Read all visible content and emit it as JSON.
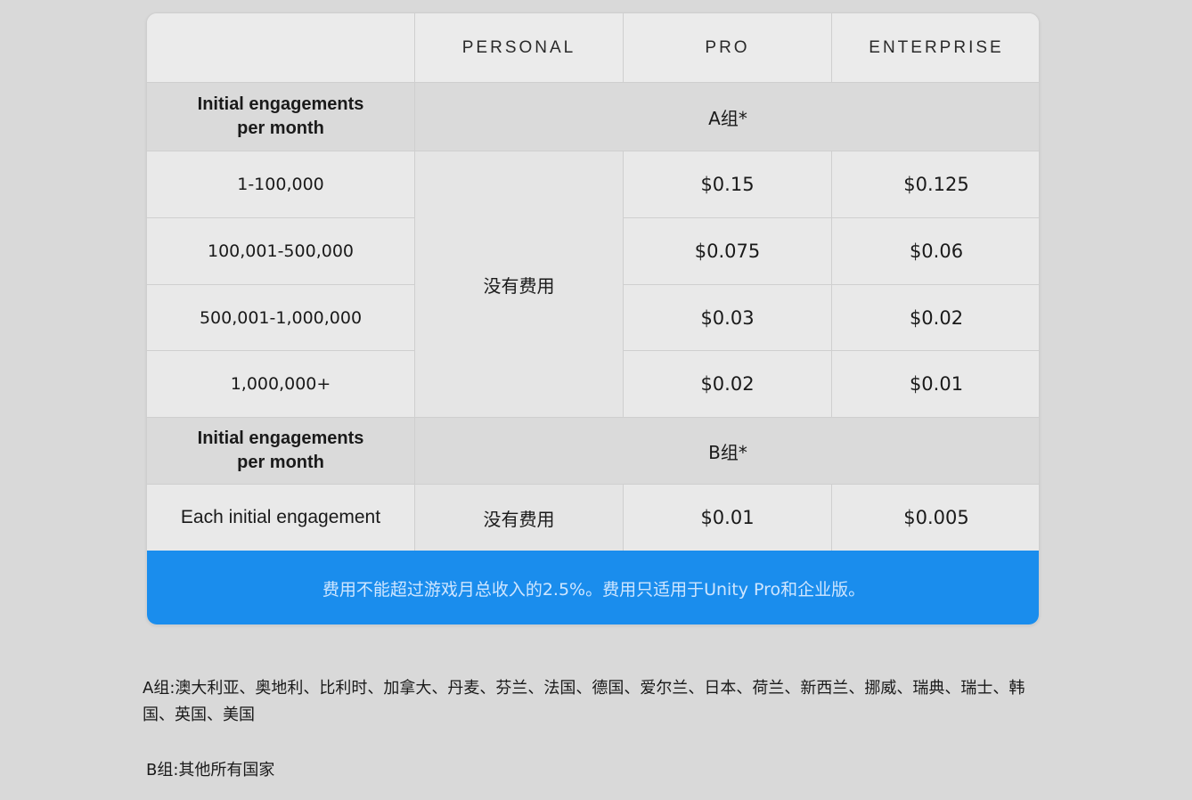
{
  "header": {
    "corner": "",
    "personal": "PERSONAL",
    "pro": "PRO",
    "enterprise": "ENTERPRISE"
  },
  "group_a": {
    "label": "Initial engagements\nper month",
    "title": "A组*",
    "personal_fee": "没有费用",
    "rows": [
      {
        "range": "1-100,000",
        "pro": "$0.15",
        "enterprise": "$0.125"
      },
      {
        "range": "100,001-500,000",
        "pro": "$0.075",
        "enterprise": "$0.06"
      },
      {
        "range": "500,001-1,000,000",
        "pro": "$0.03",
        "enterprise": "$0.02"
      },
      {
        "range": "1,000,000+",
        "pro": "$0.02",
        "enterprise": "$0.01"
      }
    ]
  },
  "group_b": {
    "label": "Initial engagements\nper month",
    "title": "B组*",
    "row": {
      "range": "Each initial engagement",
      "personal": "没有费用",
      "pro": "$0.01",
      "enterprise": "$0.005"
    }
  },
  "footer": {
    "text": "费用不能超过游戏月总收入的2.5%。费用只适用于Unity Pro和企业版。"
  },
  "notes": {
    "group_a": "A组:澳大利亚、奥地利、比利时、加拿大、丹麦、芬兰、法国、德国、爱尔兰、日本、荷兰、新西兰、挪威、瑞典、瑞士、韩国、英国、美国",
    "group_b": "B组:其他所有国家"
  },
  "colors": {
    "background": "#d9d9d9",
    "cell": "#e9e9e9",
    "section": "#dadada",
    "footer": "#1a8ded"
  }
}
